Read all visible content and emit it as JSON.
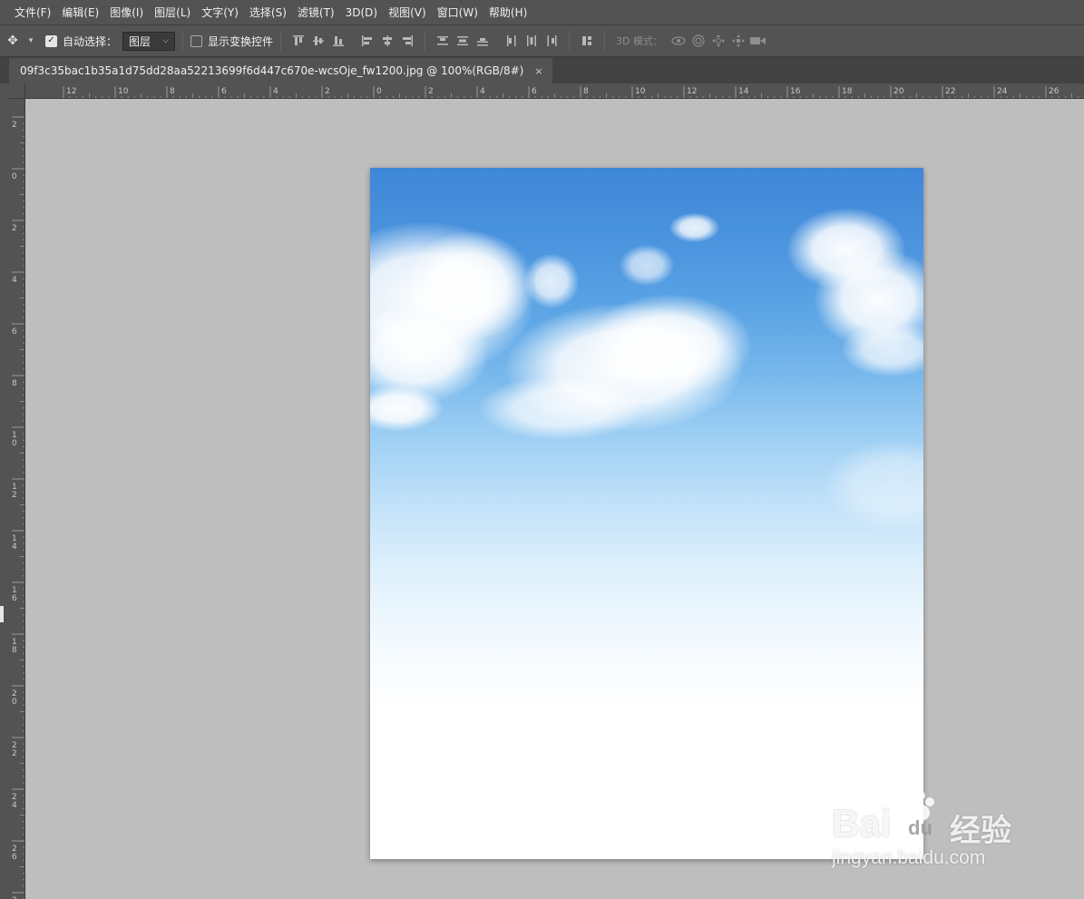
{
  "menubar": {
    "items": [
      "文件(F)",
      "编辑(E)",
      "图像(I)",
      "图层(L)",
      "文字(Y)",
      "选择(S)",
      "滤镜(T)",
      "3D(D)",
      "视图(V)",
      "窗口(W)",
      "帮助(H)"
    ]
  },
  "options": {
    "auto_select_label": "自动选择：",
    "auto_select_checked": true,
    "auto_select_target": "图层",
    "show_transform_label": "显示变换控件",
    "show_transform_checked": false,
    "mode_3d_label": "3D 模式："
  },
  "document": {
    "tab_title": "09f3c35bac1b35a1d75dd28aa52213699f6d447c670e-wcsOje_fw1200.jpg @ 100%(RGB/8#)",
    "close_glyph": "×"
  },
  "rulers": {
    "horizontal_labels": [
      "12",
      "10",
      "8",
      "6",
      "4",
      "2",
      "0",
      "2",
      "4",
      "6",
      "8",
      "10",
      "12",
      "14",
      "16",
      "18",
      "20",
      "22",
      "24",
      "26"
    ],
    "vertical_labels": [
      "2",
      "0",
      "2",
      "4",
      "6",
      "8",
      "10",
      "12",
      "14",
      "16",
      "18",
      "20",
      "22",
      "24",
      "26",
      "2"
    ]
  },
  "watermark": {
    "brand": "Bai",
    "brand_paw": "du",
    "brand_suffix": "经验",
    "url": "jingyan.baidu.com"
  },
  "colors": {
    "sky_top": "#3f87d8",
    "canvas_bg": "#bebebe",
    "ui_dark": "#535353"
  }
}
